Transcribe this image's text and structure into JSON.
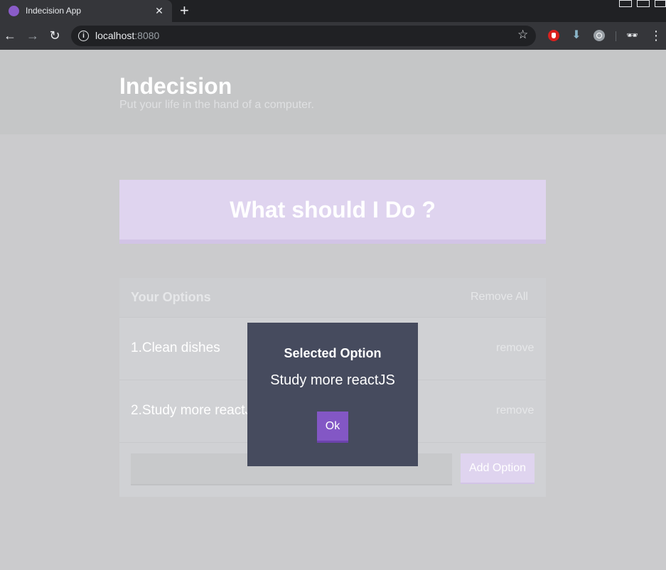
{
  "browser": {
    "tab_title": "Indecision App",
    "url_host": "localhost",
    "url_port": ":8080"
  },
  "header": {
    "title": "Indecision",
    "subtitle": "Put your life in the hand of a computer."
  },
  "main": {
    "action_button": "What should I Do ?",
    "options_title": "Your Options",
    "remove_all_label": "Remove All",
    "options": [
      {
        "text": "1.Clean dishes",
        "remove_label": "remove"
      },
      {
        "text": "2.Study more reactJS",
        "remove_label": "remove"
      }
    ],
    "add_option_label": "Add Option"
  },
  "modal": {
    "title": "Selected Option",
    "body": "Study more reactJS",
    "ok_label": "Ok"
  },
  "colors": {
    "accent": "#8357c5",
    "modal_bg": "#464b5e"
  }
}
